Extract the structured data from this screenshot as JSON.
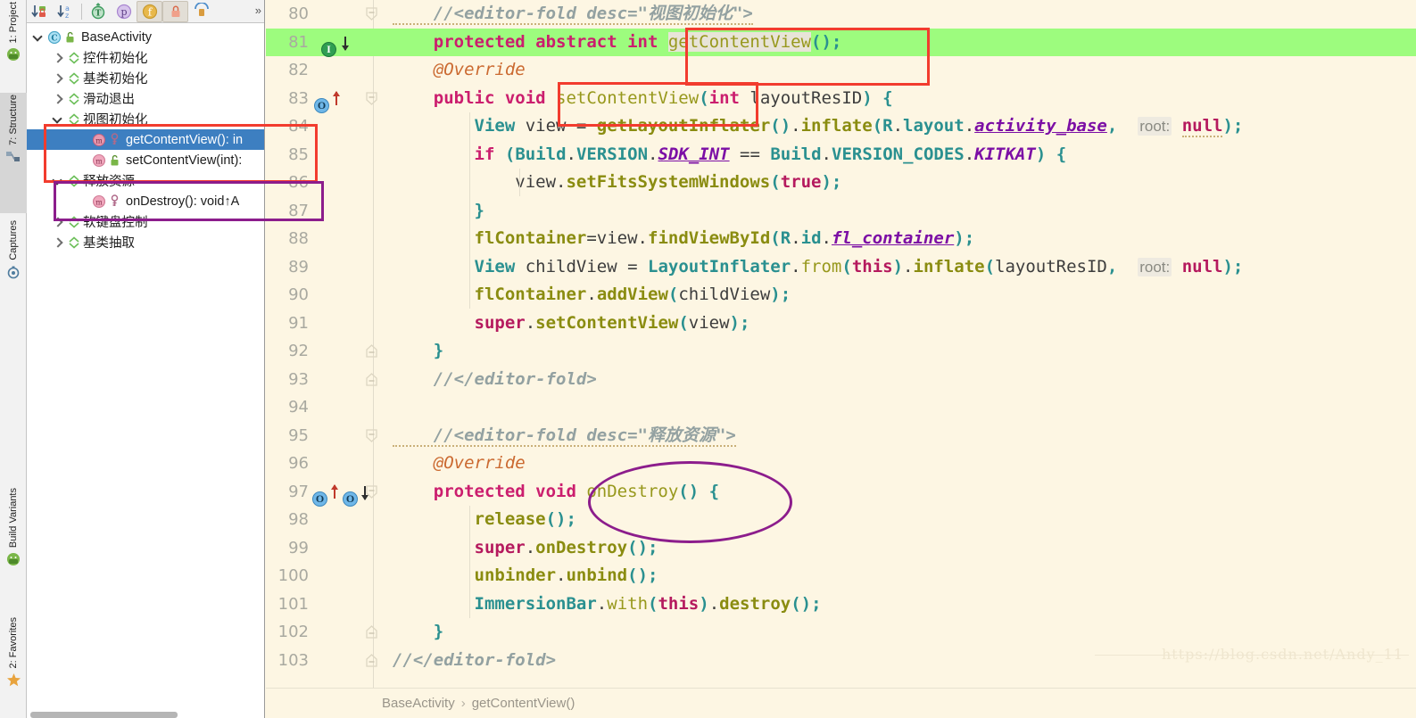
{
  "toolwindow_tabs": [
    {
      "label": "1: Project",
      "icon": "android-icon",
      "selected": false
    },
    {
      "label": "7: Structure",
      "icon": "structure-icon",
      "selected": true
    },
    {
      "label": "Captures",
      "icon": "captures-icon",
      "selected": false
    },
    {
      "label": "Build Variants",
      "icon": "android-icon",
      "selected": false
    },
    {
      "label": "2: Favorites",
      "icon": "star-icon",
      "selected": false
    }
  ],
  "structure_toolbar": {
    "buttons": [
      {
        "name": "sort-by-visibility-button",
        "glyph": "↓",
        "badge": "🔒",
        "active": false
      },
      {
        "name": "sort-alphabetically-button",
        "glyph": "↓",
        "badge": "az",
        "active": false
      },
      {
        "name": "show-inherited-button",
        "glyph": "T",
        "active": false
      },
      {
        "name": "show-properties-button",
        "glyph": "p",
        "active": false
      },
      {
        "name": "show-fields-button",
        "glyph": "f",
        "active": true
      },
      {
        "name": "show-non-public-button",
        "glyph": "🔒",
        "active": true
      },
      {
        "name": "show-anonymous-classes-button",
        "glyph": "☂",
        "active": false
      }
    ],
    "overflow_label": "»"
  },
  "structure_tree": [
    {
      "label": "BaseActivity",
      "suffix": "",
      "depth": 0,
      "expander": "down",
      "icon": "class-icon",
      "badge": "unlock-icon",
      "selected": false
    },
    {
      "label": "控件初始化",
      "suffix": "",
      "depth": 1,
      "expander": "right",
      "icon": "region-icon",
      "badge": "",
      "selected": false
    },
    {
      "label": "基类初始化",
      "suffix": "",
      "depth": 1,
      "expander": "right",
      "icon": "region-icon",
      "badge": "",
      "selected": false
    },
    {
      "label": "滑动退出",
      "suffix": "",
      "depth": 1,
      "expander": "right",
      "icon": "region-icon",
      "badge": "",
      "selected": false
    },
    {
      "label": "视图初始化",
      "suffix": "",
      "depth": 1,
      "expander": "down",
      "icon": "region-icon",
      "badge": "",
      "selected": false
    },
    {
      "label": "getContentView(): in",
      "suffix": "",
      "depth": 2,
      "expander": "none",
      "icon": "method-icon",
      "badge": "protected-icon",
      "selected": true
    },
    {
      "label": "setContentView(int):",
      "suffix": "",
      "depth": 2,
      "expander": "none",
      "icon": "method-icon",
      "badge": "unlock-icon",
      "selected": false
    },
    {
      "label": "释放资源",
      "suffix": "",
      "depth": 1,
      "expander": "down",
      "icon": "region-icon",
      "badge": "",
      "selected": false
    },
    {
      "label": "onDestroy(): void ",
      "suffix": "↑A",
      "depth": 2,
      "expander": "none",
      "icon": "method-icon",
      "badge": "protected-icon",
      "selected": false
    },
    {
      "label": "软键盘控制",
      "suffix": "",
      "depth": 1,
      "expander": "right",
      "icon": "region-icon",
      "badge": "",
      "selected": false
    },
    {
      "label": "基类抽取",
      "suffix": "",
      "depth": 1,
      "expander": "right",
      "icon": "region-icon",
      "badge": "",
      "selected": false
    }
  ],
  "editor": {
    "first_line": 80,
    "highlighted_line": 81,
    "lines": [
      {
        "no": 80,
        "fold": "collapse",
        "markers": []
      },
      {
        "no": 81,
        "fold": "none",
        "markers": [
          "implemented-down"
        ]
      },
      {
        "no": 82,
        "fold": "none",
        "markers": []
      },
      {
        "no": 83,
        "fold": "collapse",
        "markers": [
          "overrides-up"
        ]
      },
      {
        "no": 84,
        "fold": "none",
        "markers": []
      },
      {
        "no": 85,
        "fold": "none",
        "markers": []
      },
      {
        "no": 86,
        "fold": "none",
        "markers": []
      },
      {
        "no": 87,
        "fold": "none",
        "markers": []
      },
      {
        "no": 88,
        "fold": "none",
        "markers": []
      },
      {
        "no": 89,
        "fold": "none",
        "markers": []
      },
      {
        "no": 90,
        "fold": "none",
        "markers": []
      },
      {
        "no": 91,
        "fold": "none",
        "markers": []
      },
      {
        "no": 92,
        "fold": "collapse",
        "markers": []
      },
      {
        "no": 93,
        "fold": "collapse",
        "markers": []
      },
      {
        "no": 94,
        "fold": "none",
        "markers": []
      },
      {
        "no": 95,
        "fold": "collapse",
        "markers": []
      },
      {
        "no": 96,
        "fold": "none",
        "markers": []
      },
      {
        "no": 97,
        "fold": "collapse",
        "markers": [
          "overrides-up",
          "overridden-down"
        ]
      },
      {
        "no": 98,
        "fold": "none",
        "markers": []
      },
      {
        "no": 99,
        "fold": "none",
        "markers": []
      },
      {
        "no": 100,
        "fold": "none",
        "markers": []
      },
      {
        "no": 101,
        "fold": "none",
        "markers": []
      },
      {
        "no": 102,
        "fold": "collapse",
        "markers": []
      },
      {
        "no": 103,
        "fold": "collapse",
        "markers": []
      }
    ],
    "code_plain": [
      "    //<editor-fold desc=\"视图初始化\">",
      "    protected abstract int getContentView();",
      "    @Override",
      "    public void setContentView(int layoutResID) {",
      "        View view = getLayoutInflater().inflate(R.layout.activity_base,  root: null);",
      "        if (Build.VERSION.SDK_INT == Build.VERSION_CODES.KITKAT) {",
      "            view.setFitsSystemWindows(true);",
      "        }",
      "        flContainer=view.findViewById(R.id.fl_container);",
      "        View childView = LayoutInflater.from(this).inflate(layoutResID,  root: null);",
      "        flContainer.addView(childView);",
      "        super.setContentView(view);",
      "    }",
      "    //</editor-fold>",
      "",
      "    //<editor-fold desc=\"释放资源\">",
      "    @Override",
      "    protected void onDestroy() {",
      "        release();",
      "        super.onDestroy();",
      "        unbinder.unbind();",
      "        ImmersionBar.with(this).destroy();",
      "    }",
      "    //</editor-fold>"
    ]
  },
  "breadcrumb": {
    "parts": [
      "BaseActivity",
      "getContentView()"
    ],
    "separator": "›"
  },
  "watermark": "https://blog.csdn.net/Andy_11",
  "colors": {
    "editor_background": "#fdf6e3",
    "highlight_line": "#9dfc7e",
    "selection_blue": "#3d7fc1",
    "annotation_red": "#f23c2e",
    "annotation_purple": "#8c1d8c",
    "keyword": "#cb1e6e",
    "comment": "#93a1a1",
    "type": "#2a9090",
    "method": "#8a8c10",
    "field": "#7c0fa5",
    "annotation_text": "#cb6a31"
  },
  "annotations": [
    {
      "name": "red-box-structure",
      "shape": "rect",
      "color": "#f23c2e"
    },
    {
      "name": "purple-box-structure",
      "shape": "rect",
      "color": "#8c1d8c"
    },
    {
      "name": "red-box-getcontentview",
      "shape": "rect",
      "color": "#f23c2e"
    },
    {
      "name": "red-box-setcontentview",
      "shape": "rect",
      "color": "#f23c2e"
    },
    {
      "name": "purple-ellipse-ondestroy",
      "shape": "ellipse",
      "color": "#8c1d8c"
    }
  ]
}
